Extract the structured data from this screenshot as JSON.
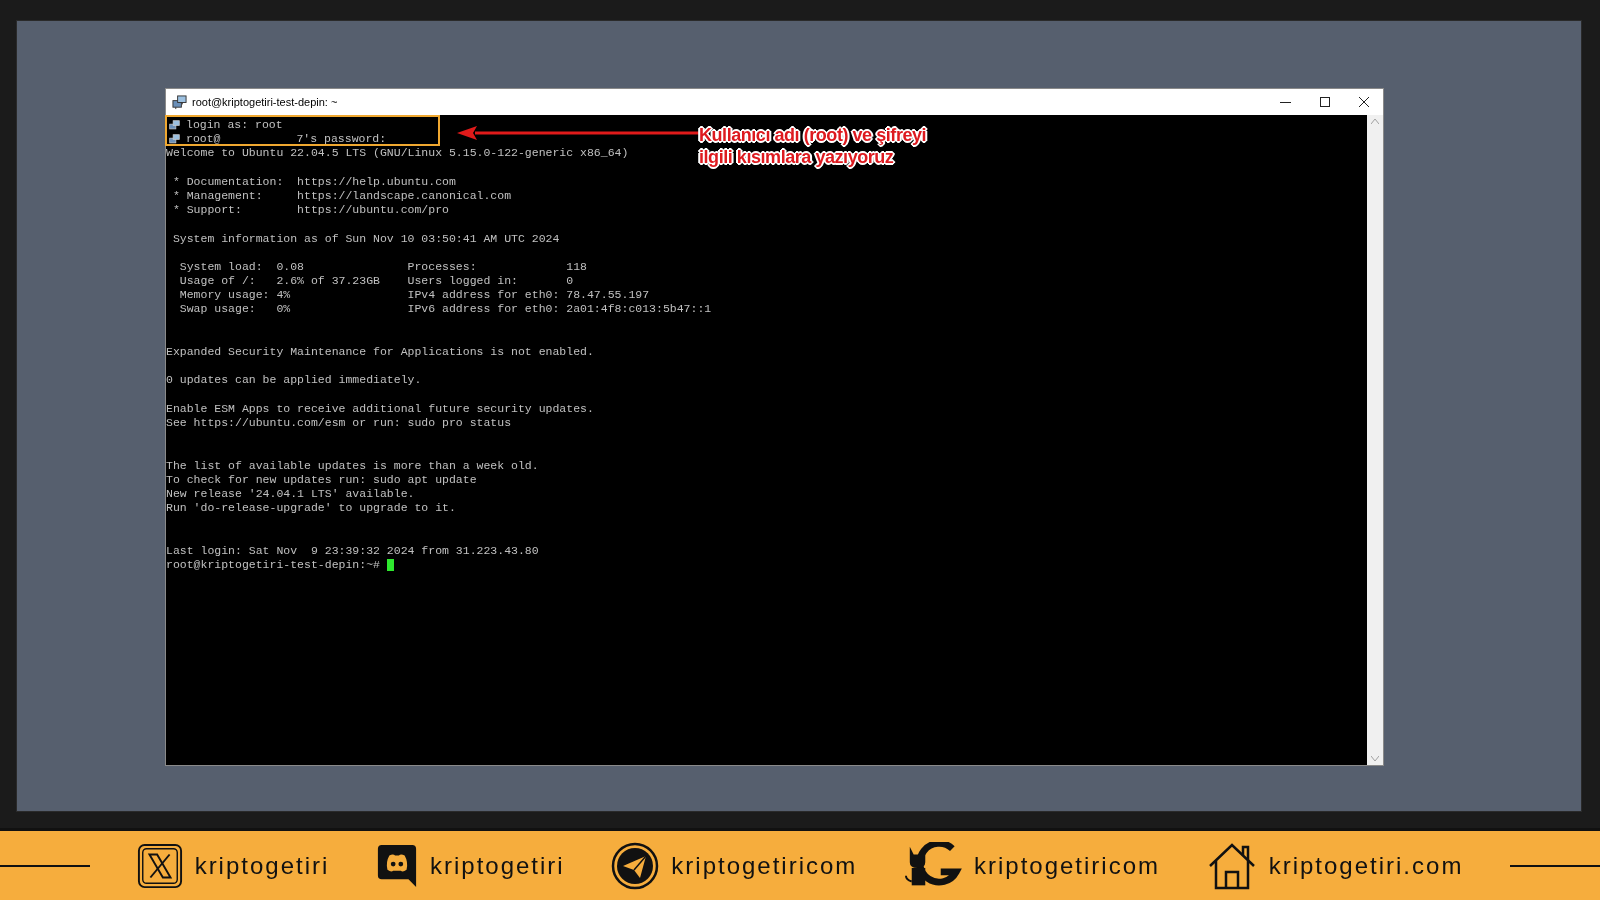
{
  "window": {
    "title": "root@kriptogetiri-test-depin: ~"
  },
  "terminal": {
    "lines": [
      {
        "kind": "session",
        "text": "login as: root"
      },
      {
        "kind": "session",
        "text": "root@           7's password:"
      },
      {
        "kind": "plain",
        "text": "Welcome to Ubuntu 22.04.5 LTS (GNU/Linux 5.15.0-122-generic x86_64)"
      },
      {
        "kind": "blank"
      },
      {
        "kind": "plain",
        "text": " * Documentation:  https://help.ubuntu.com"
      },
      {
        "kind": "plain",
        "text": " * Management:     https://landscape.canonical.com"
      },
      {
        "kind": "plain",
        "text": " * Support:        https://ubuntu.com/pro"
      },
      {
        "kind": "blank"
      },
      {
        "kind": "plain",
        "text": " System information as of Sun Nov 10 03:50:41 AM UTC 2024"
      },
      {
        "kind": "blank"
      },
      {
        "kind": "plain",
        "text": "  System load:  0.08               Processes:             118"
      },
      {
        "kind": "plain",
        "text": "  Usage of /:   2.6% of 37.23GB    Users logged in:       0"
      },
      {
        "kind": "plain",
        "text": "  Memory usage: 4%                 IPv4 address for eth0: 78.47.55.197"
      },
      {
        "kind": "plain",
        "text": "  Swap usage:   0%                 IPv6 address for eth0: 2a01:4f8:c013:5b47::1"
      },
      {
        "kind": "blank"
      },
      {
        "kind": "blank"
      },
      {
        "kind": "plain",
        "text": "Expanded Security Maintenance for Applications is not enabled."
      },
      {
        "kind": "blank"
      },
      {
        "kind": "plain",
        "text": "0 updates can be applied immediately."
      },
      {
        "kind": "blank"
      },
      {
        "kind": "plain",
        "text": "Enable ESM Apps to receive additional future security updates."
      },
      {
        "kind": "plain",
        "text": "See https://ubuntu.com/esm or run: sudo pro status"
      },
      {
        "kind": "blank"
      },
      {
        "kind": "blank"
      },
      {
        "kind": "plain",
        "text": "The list of available updates is more than a week old."
      },
      {
        "kind": "plain",
        "text": "To check for new updates run: sudo apt update"
      },
      {
        "kind": "plain",
        "text": "New release '24.04.1 LTS' available."
      },
      {
        "kind": "plain",
        "text": "Run 'do-release-upgrade' to upgrade to it."
      },
      {
        "kind": "blank"
      },
      {
        "kind": "blank"
      },
      {
        "kind": "plain",
        "text": "Last login: Sat Nov  9 23:39:32 2024 from 31.223.43.80"
      },
      {
        "kind": "prompt",
        "text": "root@kriptogetiri-test-depin:~# "
      }
    ]
  },
  "annotation": {
    "lines": [
      "Kullanıcı adı (root) ve şifreyi",
      "ilgili kısımlara yazıyoruz"
    ]
  },
  "footer": {
    "links": [
      {
        "kind": "x",
        "text": "kriptogetiri"
      },
      {
        "kind": "discord",
        "text": "kriptogetiri"
      },
      {
        "kind": "telegram",
        "text": "kriptogetiricom"
      },
      {
        "kind": "github",
        "text": "kriptogetiricom"
      },
      {
        "kind": "home",
        "text": "kriptogetiri.com"
      }
    ]
  }
}
